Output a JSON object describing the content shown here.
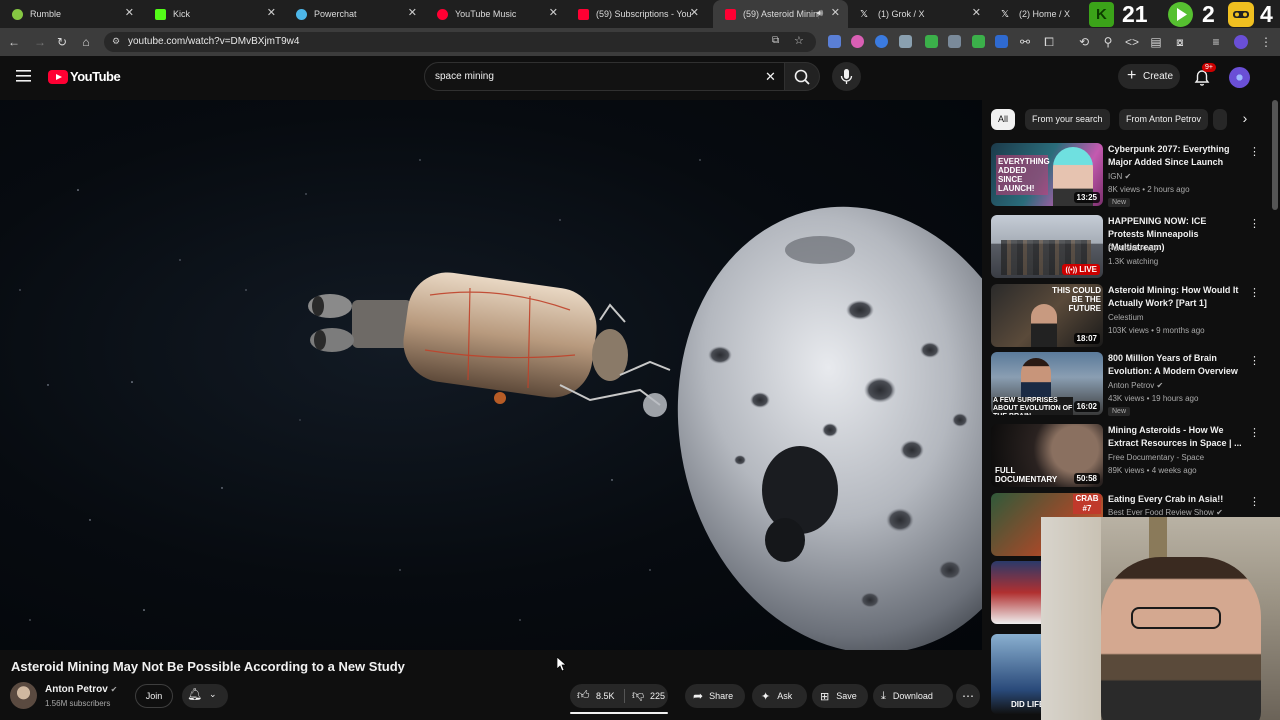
{
  "browser": {
    "tabs": [
      {
        "label": "Rumble",
        "color": "#85c742"
      },
      {
        "label": "Kick",
        "color": "#53fc18"
      },
      {
        "label": "Powerchat",
        "color": "#4db6e8"
      },
      {
        "label": "YouTube Music",
        "color": "#ff0033"
      },
      {
        "label": "(59) Subscriptions - YouTube",
        "color": "#ff0033"
      },
      {
        "label": "(59) Asteroid Mining I",
        "color": "#ff0033",
        "active": true
      },
      {
        "label": "(1) Grok / X",
        "color": "#e7e7e7"
      },
      {
        "label": "(2) Home / X",
        "color": "#e7e7e7"
      }
    ],
    "url": "youtube.com/watch?v=DMvBXjmT9w4",
    "overlay_counters": [
      "21",
      "2",
      "4"
    ]
  },
  "youtube": {
    "logo_text": "YouTube",
    "search_value": "space mining",
    "create_label": "Create",
    "notification_badge": "9+"
  },
  "video": {
    "title": "Asteroid Mining May Not Be Possible According to a New Study",
    "channel": "Anton Petrov",
    "subscribers": "1.56M subscribers",
    "join_label": "Join",
    "likes": "8.5K",
    "dislikes": "225",
    "share_label": "Share",
    "ask_label": "Ask",
    "save_label": "Save",
    "download_label": "Download"
  },
  "chips": [
    {
      "label": "All",
      "selected": true
    },
    {
      "label": "From your search"
    },
    {
      "label": "From Anton Petrov"
    }
  ],
  "recommendations": [
    {
      "title": "Cyberpunk 2077: Everything Major Added Since Launch",
      "channel": "IGN",
      "meta": "8K views • 2 hours ago",
      "badge": "New",
      "duration": "13:25",
      "thumb_text": "EVERYTHING ADDED SINCE LAUNCH!"
    },
    {
      "title": "HAPPENING NOW: ICE Protests Minneapolis (Multistream)",
      "channel": "Portland Andy",
      "meta": "1.3K watching",
      "badge": "",
      "duration": "LIVE",
      "thumb_text": ""
    },
    {
      "title": "Asteroid Mining: How Would It Actually Work? [Part 1]",
      "channel": "Celestium",
      "meta": "103K views • 9 months ago",
      "badge": "",
      "duration": "18:07",
      "thumb_text": "THIS COULD BE THE FUTURE"
    },
    {
      "title": "800 Million Years of Brain Evolution: A Modern Overview",
      "channel": "Anton Petrov",
      "meta": "43K views • 19 hours ago",
      "badge": "New",
      "duration": "16:02",
      "thumb_text": "A FEW SURPRISES ABOUT EVOLUTION OF THE BRAIN"
    },
    {
      "title": "Mining Asteroids - How We Extract Resources in Space | ...",
      "channel": "Free Documentary - Space",
      "meta": "89K views • 4 weeks ago",
      "badge": "",
      "duration": "50:58",
      "thumb_text": "FULL DOCUMENTARY"
    },
    {
      "title": "Eating Every Crab in Asia!!",
      "channel": "Best Ever Food Review Show",
      "meta": "",
      "badge": "",
      "duration": "",
      "thumb_text": "CRAB #7"
    }
  ],
  "partial_thumbs": [
    "DID LIFE"
  ],
  "colors": {
    "bg": "#0f0f0f",
    "accent": "#ff0033",
    "avatar": "#6a4fd6"
  }
}
